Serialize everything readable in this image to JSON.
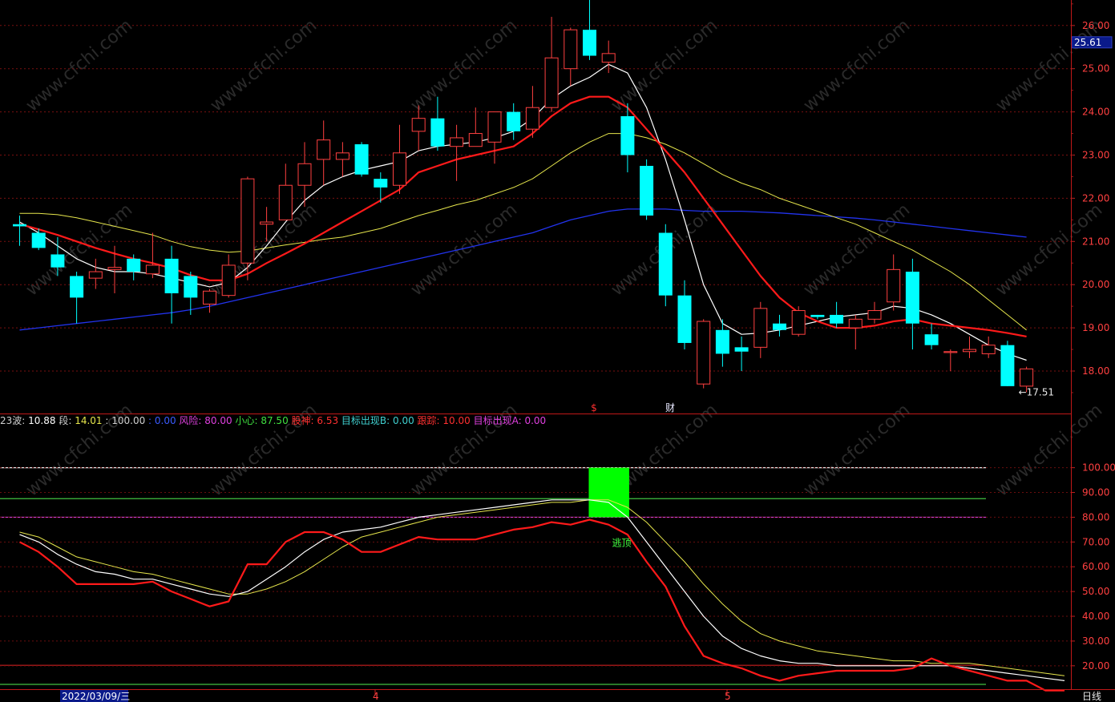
{
  "chart_data": [
    {
      "panel": "main",
      "type": "candlestick",
      "ylim": [
        17.3,
        26.8
      ],
      "grid": true,
      "y_ticks": [
        18.0,
        19.0,
        20.0,
        21.0,
        22.0,
        23.0,
        24.0,
        25.0,
        26.0
      ],
      "current_price_label": "25.61",
      "high_marker": "26.71",
      "low_marker": "17.51",
      "signal_labels": [
        {
          "text": "$",
          "color": "#ff3030"
        },
        {
          "text": "财",
          "color": "#e8e8ff"
        }
      ],
      "candles": [
        {
          "o": 21.4,
          "h": 21.6,
          "l": 20.9,
          "c": 21.35
        },
        {
          "o": 21.2,
          "h": 21.3,
          "l": 20.8,
          "c": 20.85
        },
        {
          "o": 20.7,
          "h": 21.1,
          "l": 20.2,
          "c": 20.4
        },
        {
          "o": 20.2,
          "h": 20.3,
          "l": 19.1,
          "c": 19.7
        },
        {
          "o": 20.15,
          "h": 20.6,
          "l": 19.9,
          "c": 20.3
        },
        {
          "o": 20.35,
          "h": 20.9,
          "l": 19.8,
          "c": 20.4
        },
        {
          "o": 20.6,
          "h": 20.7,
          "l": 20.1,
          "c": 20.3
        },
        {
          "o": 20.25,
          "h": 21.2,
          "l": 20.15,
          "c": 20.45
        },
        {
          "o": 20.6,
          "h": 20.9,
          "l": 19.1,
          "c": 19.8
        },
        {
          "o": 20.2,
          "h": 20.3,
          "l": 19.3,
          "c": 19.7
        },
        {
          "o": 19.55,
          "h": 19.9,
          "l": 19.35,
          "c": 19.85
        },
        {
          "o": 19.75,
          "h": 20.7,
          "l": 19.7,
          "c": 20.45
        },
        {
          "o": 20.5,
          "h": 22.5,
          "l": 20.1,
          "c": 22.45
        },
        {
          "o": 21.4,
          "h": 21.8,
          "l": 21.0,
          "c": 21.45
        },
        {
          "o": 21.5,
          "h": 22.8,
          "l": 21.5,
          "c": 22.3
        },
        {
          "o": 22.3,
          "h": 23.3,
          "l": 21.8,
          "c": 22.8
        },
        {
          "o": 22.9,
          "h": 23.8,
          "l": 22.3,
          "c": 23.35
        },
        {
          "o": 22.9,
          "h": 23.3,
          "l": 22.5,
          "c": 23.05
        },
        {
          "o": 23.25,
          "h": 23.3,
          "l": 22.5,
          "c": 22.55
        },
        {
          "o": 22.45,
          "h": 22.6,
          "l": 21.9,
          "c": 22.25
        },
        {
          "o": 22.3,
          "h": 23.7,
          "l": 22.1,
          "c": 23.05
        },
        {
          "o": 23.55,
          "h": 24.15,
          "l": 23.1,
          "c": 23.85
        },
        {
          "o": 23.85,
          "h": 24.35,
          "l": 23.1,
          "c": 23.2
        },
        {
          "o": 23.2,
          "h": 23.7,
          "l": 22.4,
          "c": 23.4
        },
        {
          "o": 23.2,
          "h": 24.1,
          "l": 23.2,
          "c": 23.5
        },
        {
          "o": 23.3,
          "h": 24.0,
          "l": 22.8,
          "c": 24.0
        },
        {
          "o": 24.0,
          "h": 24.2,
          "l": 23.35,
          "c": 23.55
        },
        {
          "o": 23.6,
          "h": 24.6,
          "l": 23.4,
          "c": 24.1
        },
        {
          "o": 24.1,
          "h": 26.2,
          "l": 24.0,
          "c": 25.25
        },
        {
          "o": 25.0,
          "h": 25.95,
          "l": 24.6,
          "c": 25.9
        },
        {
          "o": 25.9,
          "h": 26.71,
          "l": 25.2,
          "c": 25.3
        },
        {
          "o": 25.15,
          "h": 25.65,
          "l": 24.9,
          "c": 25.35
        },
        {
          "o": 23.9,
          "h": 24.2,
          "l": 22.6,
          "c": 23.0
        },
        {
          "o": 22.75,
          "h": 22.9,
          "l": 21.5,
          "c": 21.6
        },
        {
          "o": 21.2,
          "h": 21.4,
          "l": 19.5,
          "c": 19.75
        },
        {
          "o": 19.75,
          "h": 20.1,
          "l": 18.5,
          "c": 18.65
        },
        {
          "o": 17.7,
          "h": 19.2,
          "l": 17.6,
          "c": 19.15
        },
        {
          "o": 18.95,
          "h": 19.2,
          "l": 18.1,
          "c": 18.4
        },
        {
          "o": 18.55,
          "h": 18.8,
          "l": 18.0,
          "c": 18.45
        },
        {
          "o": 18.55,
          "h": 19.6,
          "l": 18.3,
          "c": 19.45
        },
        {
          "o": 19.1,
          "h": 19.3,
          "l": 18.8,
          "c": 18.95
        },
        {
          "o": 18.85,
          "h": 19.5,
          "l": 18.8,
          "c": 19.4
        },
        {
          "o": 19.3,
          "h": 19.3,
          "l": 19.2,
          "c": 19.25
        },
        {
          "o": 19.3,
          "h": 19.6,
          "l": 19.0,
          "c": 19.1
        },
        {
          "o": 19.0,
          "h": 19.3,
          "l": 18.5,
          "c": 19.2
        },
        {
          "o": 19.2,
          "h": 19.6,
          "l": 19.1,
          "c": 19.4
        },
        {
          "o": 19.6,
          "h": 20.7,
          "l": 19.4,
          "c": 20.35
        },
        {
          "o": 20.3,
          "h": 20.6,
          "l": 18.5,
          "c": 19.1
        },
        {
          "o": 18.85,
          "h": 19.1,
          "l": 18.5,
          "c": 18.6
        },
        {
          "o": 18.45,
          "h": 18.5,
          "l": 18.0,
          "c": 18.45
        },
        {
          "o": 18.45,
          "h": 18.8,
          "l": 18.3,
          "c": 18.5
        },
        {
          "o": 18.4,
          "h": 18.8,
          "l": 18.3,
          "c": 18.6
        },
        {
          "o": 18.6,
          "h": 18.7,
          "l": 17.65,
          "c": 17.65
        },
        {
          "o": 17.65,
          "h": 18.1,
          "l": 17.51,
          "c": 18.05
        }
      ],
      "lines": [
        {
          "color": "#ff1a1a",
          "width": 2.2,
          "values": [
            21.4,
            21.28,
            21.15,
            21.0,
            20.85,
            20.72,
            20.6,
            20.5,
            20.38,
            20.22,
            20.1,
            20.1,
            20.25,
            20.5,
            20.72,
            20.95,
            21.2,
            21.45,
            21.7,
            21.95,
            22.2,
            22.6,
            22.75,
            22.9,
            23.0,
            23.1,
            23.2,
            23.5,
            23.9,
            24.2,
            24.35,
            24.35,
            24.1,
            23.6,
            23.1,
            22.6,
            22.0,
            21.4,
            20.8,
            20.2,
            19.7,
            19.35,
            19.15,
            19.0,
            19.0,
            19.05,
            19.15,
            19.2,
            19.1,
            19.05,
            19.0,
            18.95,
            18.88,
            18.8
          ]
        },
        {
          "color": "#ffffff",
          "width": 1.2,
          "values": [
            21.45,
            21.2,
            20.9,
            20.6,
            20.4,
            20.3,
            20.3,
            20.25,
            20.15,
            20.05,
            19.95,
            20.05,
            20.4,
            20.9,
            21.45,
            21.95,
            22.3,
            22.5,
            22.65,
            22.75,
            22.85,
            23.1,
            23.2,
            23.25,
            23.3,
            23.4,
            23.55,
            23.85,
            24.3,
            24.6,
            24.8,
            25.1,
            24.9,
            24.1,
            22.9,
            21.5,
            20.0,
            19.1,
            18.85,
            18.88,
            18.95,
            19.05,
            19.15,
            19.25,
            19.3,
            19.35,
            19.5,
            19.45,
            19.3,
            19.1,
            18.85,
            18.6,
            18.4,
            18.25
          ]
        },
        {
          "color": "#e6e64c",
          "width": 1.0,
          "values": [
            21.65,
            21.65,
            21.62,
            21.55,
            21.45,
            21.35,
            21.25,
            21.15,
            21.0,
            20.88,
            20.8,
            20.75,
            20.78,
            20.85,
            20.92,
            20.98,
            21.05,
            21.1,
            21.2,
            21.3,
            21.45,
            21.6,
            21.72,
            21.85,
            21.95,
            22.1,
            22.25,
            22.45,
            22.75,
            23.05,
            23.3,
            23.5,
            23.5,
            23.4,
            23.25,
            23.05,
            22.8,
            22.55,
            22.35,
            22.2,
            22.0,
            21.85,
            21.7,
            21.55,
            21.4,
            21.2,
            21.0,
            20.8,
            20.55,
            20.3,
            20.0,
            19.65,
            19.3,
            18.95
          ]
        },
        {
          "color": "#2233ee",
          "width": 1.3,
          "values": [
            18.95,
            19.0,
            19.05,
            19.1,
            19.15,
            19.2,
            19.25,
            19.3,
            19.35,
            19.42,
            19.5,
            19.6,
            19.7,
            19.8,
            19.9,
            20.0,
            20.1,
            20.2,
            20.3,
            20.4,
            20.5,
            20.6,
            20.7,
            20.8,
            20.9,
            21.0,
            21.1,
            21.2,
            21.35,
            21.5,
            21.6,
            21.7,
            21.75,
            21.75,
            21.75,
            21.72,
            21.7,
            21.7,
            21.7,
            21.68,
            21.66,
            21.63,
            21.6,
            21.57,
            21.54,
            21.5,
            21.45,
            21.4,
            21.35,
            21.3,
            21.25,
            21.2,
            21.15,
            21.1
          ]
        }
      ]
    },
    {
      "panel": "indicator",
      "type": "line",
      "ylim": [
        12,
        100
      ],
      "y_ticks": [
        20.0,
        30.0,
        40.0,
        50.0,
        60.0,
        70.0,
        80.0,
        90.0,
        100.0
      ],
      "legend": [
        {
          "text": "23",
          "color": "#d0d0d0"
        },
        {
          "text": "波: ",
          "color": "#d0d0d0"
        },
        {
          "text": "10.88",
          "color": "#ffffff"
        },
        {
          "text": " 段: ",
          "color": "#d0d0d0"
        },
        {
          "text": "14.01",
          "color": "#e6e64c"
        },
        {
          "text": "   : ",
          "color": "#d0d0d0"
        },
        {
          "text": "100.00",
          "color": "#d0d0d0"
        },
        {
          "text": " : ",
          "color": "#3a5bff"
        },
        {
          "text": "0.00",
          "color": "#3a5bff"
        },
        {
          "text": " 风险: ",
          "color": "#e040e0"
        },
        {
          "text": "80.00",
          "color": "#e040e0"
        },
        {
          "text": " 小心: ",
          "color": "#40e040"
        },
        {
          "text": "87.50",
          "color": "#40e040"
        },
        {
          "text": " 股神: ",
          "color": "#ff3030"
        },
        {
          "text": "6.53",
          "color": "#ff3030"
        },
        {
          "text": " 目标出现B: ",
          "color": "#40d0d0"
        },
        {
          "text": "0.00",
          "color": "#40d0d0"
        },
        {
          "text": " 跟踪: ",
          "color": "#ff3030"
        },
        {
          "text": "10.00",
          "color": "#ff3030"
        },
        {
          "text": " 目标出现A: ",
          "color": "#e040e0"
        },
        {
          "text": "0.00",
          "color": "#e040e0"
        }
      ],
      "hlines": [
        {
          "value": 100,
          "color": "#e8e8e8"
        },
        {
          "value": 87.5,
          "color": "#40c040"
        },
        {
          "value": 80,
          "color": "#d040d0"
        },
        {
          "value": 20.2,
          "color": "#cc2020"
        },
        {
          "value": 12.5,
          "color": "#40c040"
        }
      ],
      "signal_box": {
        "from": 30,
        "to": 32,
        "min": 80,
        "max": 100,
        "label": "逃顶"
      },
      "lines": [
        {
          "color": "#ff1a1a",
          "width": 2.2,
          "values": [
            70,
            66,
            60,
            53,
            53,
            53,
            53,
            54,
            50,
            47,
            44,
            46,
            61,
            61,
            70,
            74,
            74,
            71,
            66,
            66,
            69,
            72,
            71,
            71,
            71,
            73,
            75,
            76,
            78,
            77,
            79,
            77,
            73,
            62,
            52,
            36,
            24,
            21,
            19,
            16,
            14,
            16,
            17,
            18,
            18,
            18,
            18,
            19,
            23,
            20,
            18,
            16,
            14,
            14,
            10,
            10
          ]
        },
        {
          "color": "#ffffff",
          "width": 1.2,
          "values": [
            73,
            70,
            65,
            61,
            58,
            57,
            55,
            55,
            53,
            51,
            49,
            48,
            50,
            55,
            60,
            66,
            71,
            74,
            75,
            76,
            78,
            80,
            81,
            82,
            83,
            84,
            85,
            86,
            87,
            87,
            87,
            86,
            80,
            70,
            60,
            50,
            40,
            32,
            27,
            24,
            22,
            21,
            21,
            20,
            20,
            20,
            20,
            20,
            20,
            20,
            19,
            18,
            17,
            16,
            15,
            14
          ]
        },
        {
          "color": "#e6e64c",
          "width": 1.0,
          "values": [
            74,
            72,
            68,
            64,
            62,
            60,
            58,
            57,
            55,
            53,
            51,
            49,
            49,
            51,
            54,
            58,
            63,
            68,
            72,
            74,
            76,
            78,
            80,
            81,
            82,
            83,
            84,
            85,
            86,
            86,
            87,
            87,
            84,
            78,
            70,
            62,
            53,
            45,
            38,
            33,
            30,
            28,
            26,
            25,
            24,
            23,
            22,
            22,
            21,
            21,
            21,
            20,
            19,
            18,
            17,
            16
          ]
        }
      ]
    }
  ],
  "x_axis": {
    "labels": [
      "2022/03/09/三",
      "4",
      "5"
    ]
  },
  "period_label": "日线"
}
